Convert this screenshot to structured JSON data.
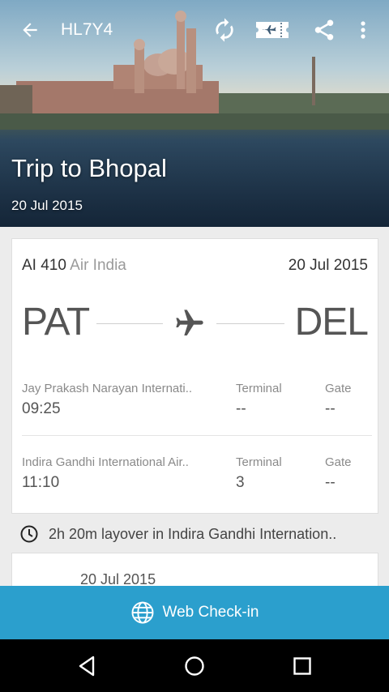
{
  "appbar": {
    "title": "HL7Y4"
  },
  "hero": {
    "trip_title": "Trip to  Bhopal",
    "trip_date": "20 Jul 2015"
  },
  "flight": {
    "number": "AI 410",
    "airline": "Air India",
    "date": "20 Jul 2015",
    "origin_code": "PAT",
    "dest_code": "DEL",
    "departure": {
      "airport": "Jay Prakash Narayan Internati..",
      "time": "09:25",
      "terminal_label": "Terminal",
      "terminal": "--",
      "gate_label": "Gate",
      "gate": "--"
    },
    "arrival": {
      "airport": "Indira Gandhi International Air..",
      "time": "11:10",
      "terminal_label": "Terminal",
      "terminal": "3",
      "gate_label": "Gate",
      "gate": "--"
    }
  },
  "layover": {
    "text": "2h 20m  layover in  Indira Gandhi Internation.."
  },
  "next_flight": {
    "date": "20 Jul 2015"
  },
  "checkin": {
    "label": "Web Check-in"
  },
  "icons": [
    "back-arrow-icon",
    "refresh-icon",
    "boarding-pass-icon",
    "share-icon",
    "more-vert-icon",
    "airplane-icon",
    "clock-icon",
    "globe-icon",
    "nav-back-icon",
    "nav-home-icon",
    "nav-recents-icon"
  ]
}
